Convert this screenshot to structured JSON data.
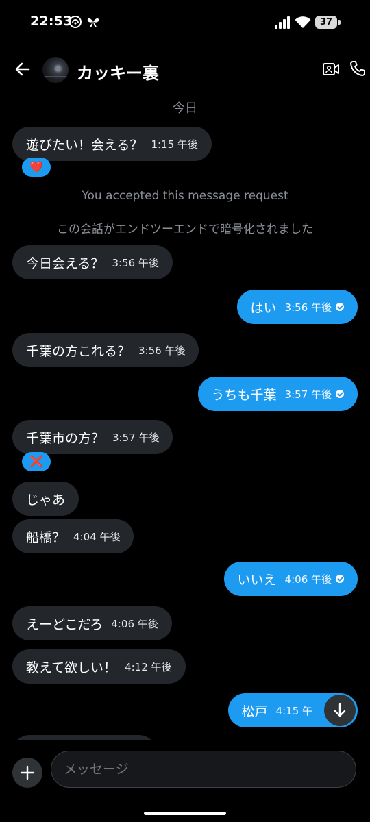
{
  "status": {
    "time": "22:53",
    "battery": "37"
  },
  "header": {
    "name": "カッキー裏"
  },
  "chat": {
    "date_label": "今日",
    "system_1": "You accepted this message request",
    "system_2": "この会話がエンドツーエンドで暗号化されました",
    "messages": [
      {
        "text": "遊びたい！会える？",
        "time": "1:15 午後",
        "dir": "in"
      },
      {
        "text": "今日会える？",
        "time": "3:56 午後",
        "dir": "in"
      },
      {
        "text": "はい",
        "time": "3:56 午後",
        "dir": "out"
      },
      {
        "text": "千葉の方これる？",
        "time": "3:56 午後",
        "dir": "in"
      },
      {
        "text": "うちも千葉",
        "time": "3:57 午後",
        "dir": "out"
      },
      {
        "text": "千葉市の方？",
        "time": "3:57 午後",
        "dir": "in"
      },
      {
        "text": "じゃあ",
        "time": "",
        "dir": "in"
      },
      {
        "text": "船橋？",
        "time": "4:04 午後",
        "dir": "in"
      },
      {
        "text": "いいえ",
        "time": "4:06 午後",
        "dir": "out"
      },
      {
        "text": "えーどこだろ",
        "time": "4:06 午後",
        "dir": "in"
      },
      {
        "text": "教えて欲しい！",
        "time": "4:12 午後",
        "dir": "in"
      },
      {
        "text": "松戸",
        "time": "4:15 午",
        "dir": "out"
      }
    ],
    "reactions": {
      "first": "❤️",
      "second": "❌"
    }
  },
  "composer": {
    "placeholder": "メッセージ"
  },
  "colors": {
    "accent": "#1d9bf0",
    "incoming": "#23262b",
    "background": "#000000"
  }
}
